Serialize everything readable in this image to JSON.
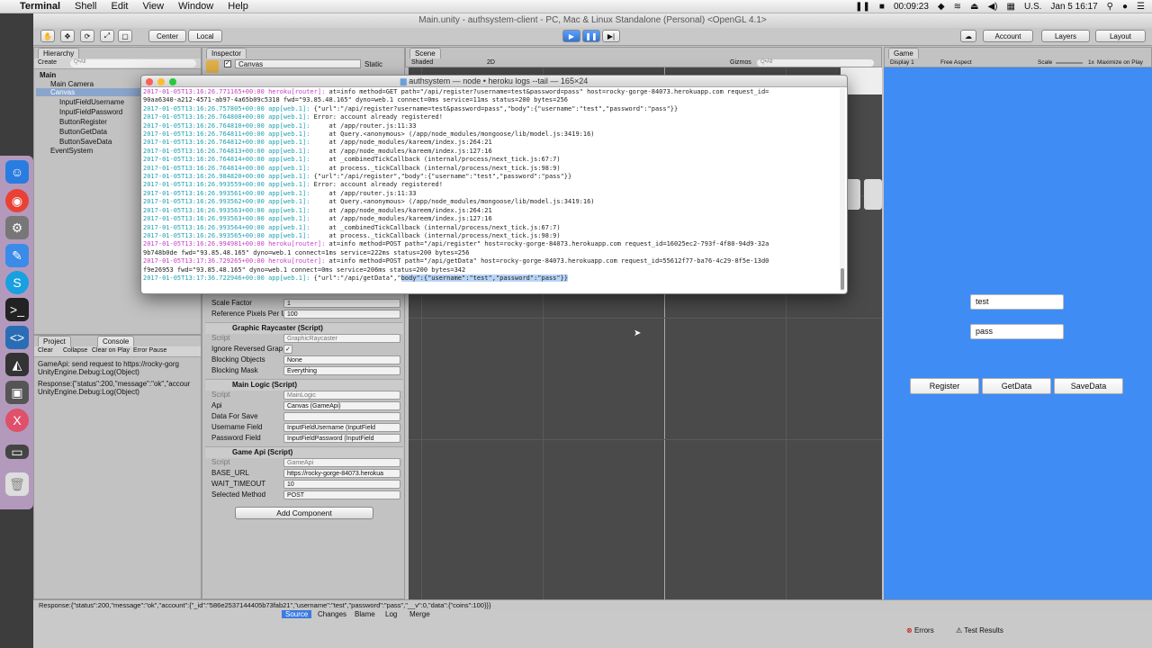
{
  "menubar": {
    "app": "Terminal",
    "items": [
      "Shell",
      "Edit",
      "View",
      "Window",
      "Help"
    ],
    "time": "00:09:23",
    "locale": "U.S.",
    "date": "Jan 5  16:17"
  },
  "unity": {
    "title": "Main.unity - authsystem-client - PC, Mac & Linux Standalone (Personal) <OpenGL 4.1>",
    "toolbar": {
      "center": "Center",
      "local": "Local",
      "account": "Account",
      "layers": "Layers",
      "layout": "Layout"
    },
    "hierarchy": {
      "tab": "Hierarchy",
      "create": "Create",
      "search": "Q•All",
      "scene": "Main",
      "items": [
        "Main Camera",
        "Canvas",
        "InputFieldUsername",
        "InputFieldPassword",
        "ButtonRegister",
        "ButtonGetData",
        "ButtonSaveData",
        "EventSystem"
      ]
    },
    "inspector": {
      "tab": "Inspector",
      "object": "Canvas",
      "static": "Static",
      "rows_top": [
        {
          "label": "Scale Factor",
          "value": "1"
        },
        {
          "label": "Reference Pixels Per U",
          "value": "100"
        }
      ],
      "raycaster": {
        "title": "Graphic Raycaster (Script)",
        "rows": [
          {
            "label": "Script",
            "value": "GraphicRaycaster"
          },
          {
            "label": "Ignore Reversed Grap",
            "value": "✓"
          },
          {
            "label": "Blocking Objects",
            "value": "None"
          },
          {
            "label": "Blocking Mask",
            "value": "Everything"
          }
        ]
      },
      "main_logic": {
        "title": "Main Logic (Script)",
        "rows": [
          {
            "label": "Script",
            "value": "MainLogic"
          },
          {
            "label": "Api",
            "value": "Canvas (GameApi)"
          },
          {
            "label": "Data For Save",
            "value": ""
          },
          {
            "label": "Username Field",
            "value": "InputFieldUsername (InputField"
          },
          {
            "label": "Password Field",
            "value": "InputFieldPassword (InputField"
          }
        ]
      },
      "game_api": {
        "title": "Game Api (Script)",
        "rows": [
          {
            "label": "Script",
            "value": "GameApi"
          },
          {
            "label": "BASE_URL",
            "value": "https://rocky-gorge-84073.herokua"
          },
          {
            "label": "WAIT_TIMEOUT",
            "value": "10"
          },
          {
            "label": "Selected Method",
            "value": "POST"
          }
        ]
      },
      "add_component": "Add Component"
    },
    "console": {
      "tabs": [
        "Project",
        "Console"
      ],
      "buttons": [
        "Clear",
        "Collapse",
        "Clear on Play",
        "Error Pause"
      ],
      "logs": [
        [
          "GameApi: send request to https://rocky-gorg",
          "UnityEngine.Debug:Log(Object)"
        ],
        [
          "Response:{\"status\":200,\"message\":\"ok\",\"accour",
          "UnityEngine.Debug:Log(Object)"
        ]
      ]
    },
    "scene": {
      "tab": "Scene",
      "shaded": "Shaded",
      "mode2d": "2D",
      "gizmos": "Gizmos",
      "search": "Q•All"
    },
    "game": {
      "tab": "Game",
      "display": "Display 1",
      "aspect": "Free Aspect",
      "scale": "Scale",
      "scale_val": "1x",
      "maximize": "Maximize on Play",
      "username": "test",
      "password": "pass",
      "buttons": [
        "Register",
        "GetData",
        "SaveData"
      ]
    },
    "status": "Response:{\"status\":200,\"message\":\"ok\",\"account\":{\"_id\":\"586e2537144405b73fab21\",\"username\":\"test\",\"password\":\"pass\",\"__v\":0,\"data\":{\"coins\":100}}}",
    "below": {
      "tabs": [
        "Source",
        "Changes",
        "Blame",
        "Log",
        "Merge"
      ],
      "errors": "Errors",
      "tests": "Test Results"
    }
  },
  "terminal": {
    "title": "authsystem — node • heroku logs --tail — 165×24",
    "lines": [
      [
        "ts2",
        "2017-01-05T13:16:26.771165+00:00 heroku[router]:",
        " at=info method=GET path=\"/api/register?username=test&password=pass\" host=rocky-gorge-84073.herokuapp.com request_id="
      ],
      [
        "",
        "",
        "90aa6340-a212-4571-ab97-4a65b09c5318 fwd=\"93.85.48.165\" dyno=web.1 connect=0ms service=11ms status=200 bytes=256"
      ],
      [
        "ts",
        "2017-01-05T13:16:26.757805+00:00 app[web.1]:",
        " {\"url\":\"/api/register?username=test&password=pass\",\"body\":{\"username\":\"test\",\"password\":\"pass\"}}"
      ],
      [
        "ts",
        "2017-01-05T13:16:26.764808+00:00 app[web.1]:",
        " Error: account already registered!"
      ],
      [
        "ts",
        "2017-01-05T13:16:26.764810+00:00 app[web.1]:",
        "     at /app/router.js:11:33"
      ],
      [
        "ts",
        "2017-01-05T13:16:26.764811+00:00 app[web.1]:",
        "     at Query.<anonymous> (/app/node_modules/mongoose/lib/model.js:3419:16)"
      ],
      [
        "ts",
        "2017-01-05T13:16:26.764812+00:00 app[web.1]:",
        "     at /app/node_modules/kareem/index.js:264:21"
      ],
      [
        "ts",
        "2017-01-05T13:16:26.764813+00:00 app[web.1]:",
        "     at /app/node_modules/kareem/index.js:127:16"
      ],
      [
        "ts",
        "2017-01-05T13:16:26.764814+00:00 app[web.1]:",
        "     at _combinedTickCallback (internal/process/next_tick.js:67:7)"
      ],
      [
        "ts",
        "2017-01-05T13:16:26.764814+00:00 app[web.1]:",
        "     at process._tickCallback (internal/process/next_tick.js:98:9)"
      ],
      [
        "ts",
        "2017-01-05T13:16:26.984820+00:00 app[web.1]:",
        " {\"url\":\"/api/register\",\"body\":{\"username\":\"test\",\"password\":\"pass\"}}"
      ],
      [
        "ts",
        "2017-01-05T13:16:26.993559+00:00 app[web.1]:",
        " Error: account already registered!"
      ],
      [
        "ts",
        "2017-01-05T13:16:26.993561+00:00 app[web.1]:",
        "     at /app/router.js:11:33"
      ],
      [
        "ts",
        "2017-01-05T13:16:26.993562+00:00 app[web.1]:",
        "     at Query.<anonymous> (/app/node_modules/mongoose/lib/model.js:3419:16)"
      ],
      [
        "ts",
        "2017-01-05T13:16:26.993563+00:00 app[web.1]:",
        "     at /app/node_modules/kareem/index.js:264:21"
      ],
      [
        "ts",
        "2017-01-05T13:16:26.993563+00:00 app[web.1]:",
        "     at /app/node_modules/kareem/index.js:127:16"
      ],
      [
        "ts",
        "2017-01-05T13:16:26.993564+00:00 app[web.1]:",
        "     at _combinedTickCallback (internal/process/next_tick.js:67:7)"
      ],
      [
        "ts",
        "2017-01-05T13:16:26.993565+00:00 app[web.1]:",
        "     at process._tickCallback (internal/process/next_tick.js:98:9)"
      ],
      [
        "ts2",
        "2017-01-05T13:16:26.994981+00:00 heroku[router]:",
        " at=info method=POST path=\"/api/register\" host=rocky-gorge-84073.herokuapp.com request_id=16025ec2-793f-4f80-94d9-32a"
      ],
      [
        "",
        "",
        "9b748b0de fwd=\"93.85.48.165\" dyno=web.1 connect=1ms service=222ms status=200 bytes=256"
      ],
      [
        "ts2",
        "2017-01-05T13:17:36.729265+00:00 heroku[router]:",
        " at=info method=POST path=\"/api/getData\" host=rocky-gorge-84073.herokuapp.com request_id=55612f77-ba76-4c29-8f5e-13d0"
      ],
      [
        "",
        "",
        "f9e26953 fwd=\"93.85.48.165\" dyno=web.1 connect=0ms service=206ms status=200 bytes=342"
      ]
    ],
    "last_line": {
      "ts": "2017-01-05T13:17:36.722946+00:00 app[web.1]:",
      "pre": " {\"url\":\"/api/getData\",\"",
      "hl": "body\":{\"username\":\"test\",\"password\":\"pass\"}}"
    }
  },
  "colors": {
    "game_bg": "#3f8cf5",
    "scene_bg": "#4a4a4a",
    "ts_app": "#1fa0b0",
    "ts_router": "#c53ec5",
    "selection": "#b7d3f5"
  }
}
